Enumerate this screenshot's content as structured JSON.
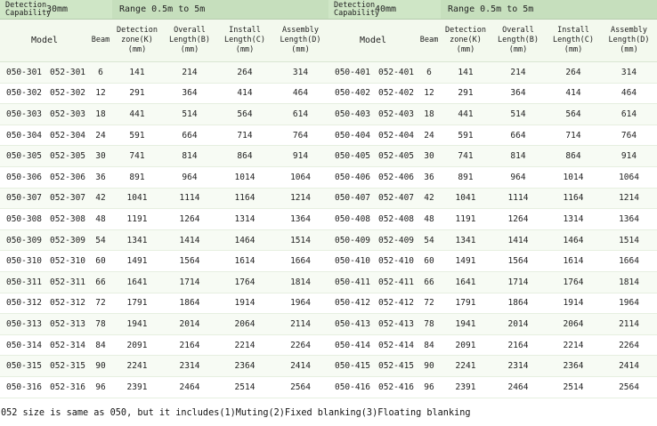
{
  "capability_label": "Detection\nCapability",
  "left": {
    "size": "30mm",
    "range": "Range 0.5m to 5m",
    "rows": [
      [
        "050-301",
        "052-301",
        "6",
        "141",
        "214",
        "264",
        "314"
      ],
      [
        "050-302",
        "052-302",
        "12",
        "291",
        "364",
        "414",
        "464"
      ],
      [
        "050-303",
        "052-303",
        "18",
        "441",
        "514",
        "564",
        "614"
      ],
      [
        "050-304",
        "052-304",
        "24",
        "591",
        "664",
        "714",
        "764"
      ],
      [
        "050-305",
        "052-305",
        "30",
        "741",
        "814",
        "864",
        "914"
      ],
      [
        "050-306",
        "052-306",
        "36",
        "891",
        "964",
        "1014",
        "1064"
      ],
      [
        "050-307",
        "052-307",
        "42",
        "1041",
        "1114",
        "1164",
        "1214"
      ],
      [
        "050-308",
        "052-308",
        "48",
        "1191",
        "1264",
        "1314",
        "1364"
      ],
      [
        "050-309",
        "052-309",
        "54",
        "1341",
        "1414",
        "1464",
        "1514"
      ],
      [
        "050-310",
        "052-310",
        "60",
        "1491",
        "1564",
        "1614",
        "1664"
      ],
      [
        "050-311",
        "052-311",
        "66",
        "1641",
        "1714",
        "1764",
        "1814"
      ],
      [
        "050-312",
        "052-312",
        "72",
        "1791",
        "1864",
        "1914",
        "1964"
      ],
      [
        "050-313",
        "052-313",
        "78",
        "1941",
        "2014",
        "2064",
        "2114"
      ],
      [
        "050-314",
        "052-314",
        "84",
        "2091",
        "2164",
        "2214",
        "2264"
      ],
      [
        "050-315",
        "052-315",
        "90",
        "2241",
        "2314",
        "2364",
        "2414"
      ],
      [
        "050-316",
        "052-316",
        "96",
        "2391",
        "2464",
        "2514",
        "2564"
      ]
    ]
  },
  "right": {
    "size": "40mm",
    "range": "Range 0.5m to 5m",
    "rows": [
      [
        "050-401",
        "052-401",
        "6",
        "141",
        "214",
        "264",
        "314"
      ],
      [
        "050-402",
        "052-402",
        "12",
        "291",
        "364",
        "414",
        "464"
      ],
      [
        "050-403",
        "052-403",
        "18",
        "441",
        "514",
        "564",
        "614"
      ],
      [
        "050-404",
        "052-404",
        "24",
        "591",
        "664",
        "714",
        "764"
      ],
      [
        "050-405",
        "052-405",
        "30",
        "741",
        "814",
        "864",
        "914"
      ],
      [
        "050-406",
        "052-406",
        "36",
        "891",
        "964",
        "1014",
        "1064"
      ],
      [
        "050-407",
        "052-407",
        "42",
        "1041",
        "1114",
        "1164",
        "1214"
      ],
      [
        "050-408",
        "052-408",
        "48",
        "1191",
        "1264",
        "1314",
        "1364"
      ],
      [
        "050-409",
        "052-409",
        "54",
        "1341",
        "1414",
        "1464",
        "1514"
      ],
      [
        "050-410",
        "052-410",
        "60",
        "1491",
        "1564",
        "1614",
        "1664"
      ],
      [
        "050-411",
        "052-411",
        "66",
        "1641",
        "1714",
        "1764",
        "1814"
      ],
      [
        "050-412",
        "052-412",
        "72",
        "1791",
        "1864",
        "1914",
        "1964"
      ],
      [
        "050-413",
        "052-413",
        "78",
        "1941",
        "2014",
        "2064",
        "2114"
      ],
      [
        "050-414",
        "052-414",
        "84",
        "2091",
        "2164",
        "2214",
        "2264"
      ],
      [
        "050-415",
        "052-415",
        "90",
        "2241",
        "2314",
        "2364",
        "2414"
      ],
      [
        "050-416",
        "052-416",
        "96",
        "2391",
        "2464",
        "2514",
        "2564"
      ]
    ]
  },
  "headers": {
    "model": "Model",
    "beam": "Beam",
    "detection_zone": "Detection zone(K)",
    "overall_length": "Overall Length(B)",
    "install_length": "Install Length(C)",
    "assembly_length": "Assembly Length(D)",
    "unit": "(mm)"
  },
  "footnote": "052 size is same as 050, but it includes(1)Muting(2)Fixed blanking(3)Floating blanking",
  "colors": {
    "capability_bg": "#cfe6c6",
    "header_bg": "#f3f9ee",
    "row_alt_bg": "#f7fbf4"
  }
}
